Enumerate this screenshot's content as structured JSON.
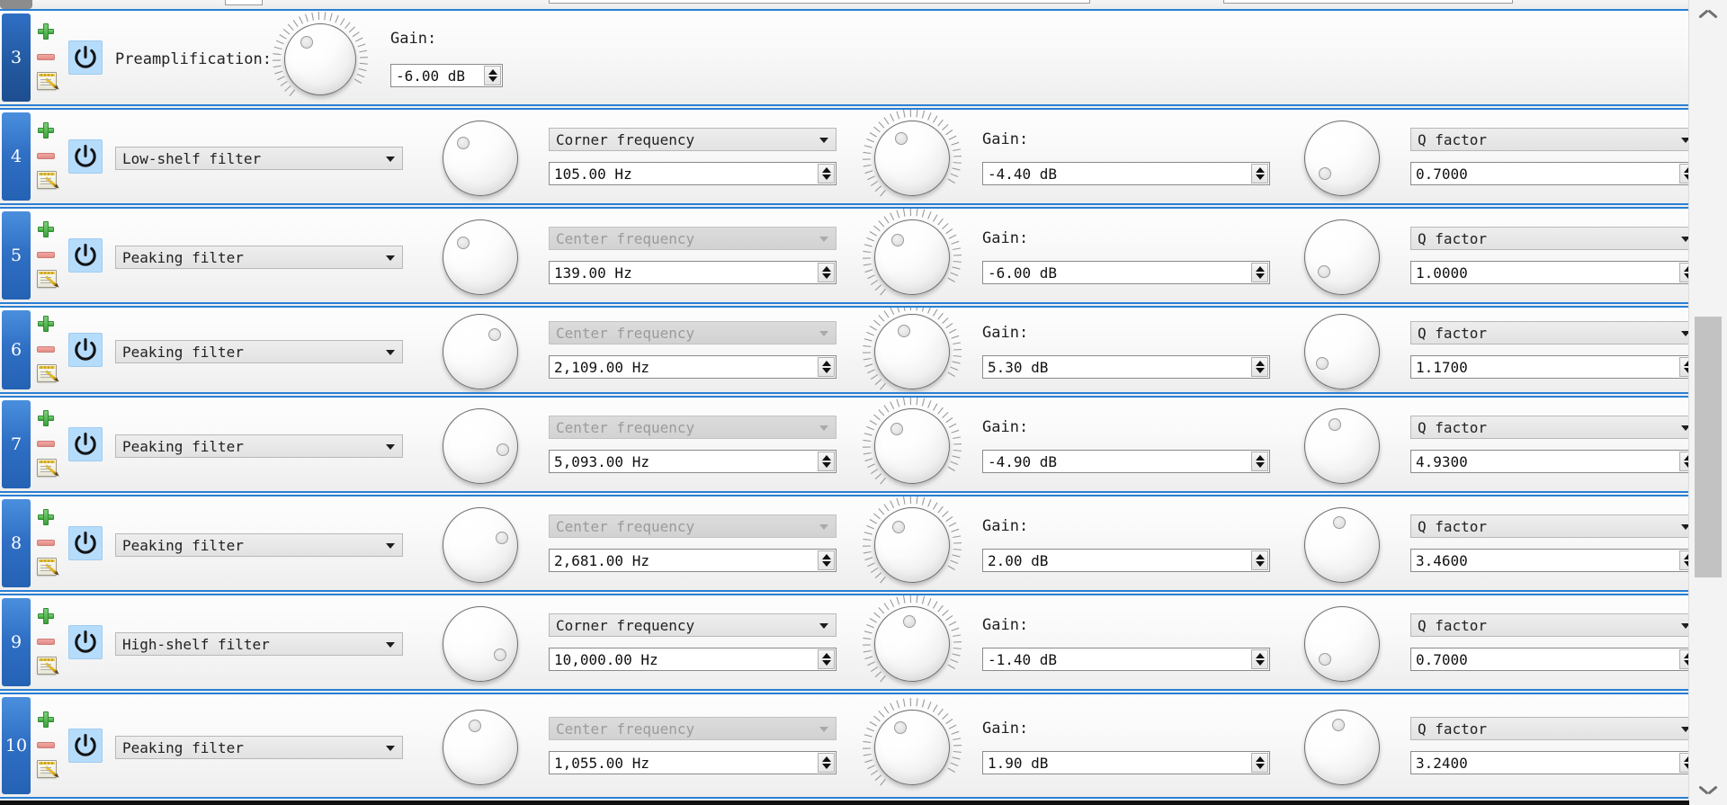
{
  "app": {
    "panel_name": "equalizer-filter-list",
    "accent_color": "#2a7fd4",
    "row_number_color": "#2f6fc4",
    "power_box_color": "#b6dcfb"
  },
  "labels": {
    "gain": "Gain:",
    "preamplification": "Preamplification:"
  },
  "icons": {
    "add": "plus-icon",
    "remove": "minus-icon",
    "edit": "note-edit-icon",
    "power": "power-icon",
    "dropdown": "chevron-down-icon",
    "spin_up": "spinner-up-icon",
    "spin_down": "spinner-down-icon",
    "scroll_up": "chevron-up-icon",
    "scroll_down": "chevron-down-icon"
  },
  "rows": [
    {
      "number": "3",
      "kind": "preamp",
      "label": "Preamplification:",
      "gain_label": "Gain:",
      "gain_value": "-6.00 dB",
      "gain_knob_angle": -38
    },
    {
      "number": "4",
      "kind": "filter",
      "filter_type": "Low-shelf filter",
      "freq_label": "Corner frequency",
      "freq_disabled": false,
      "freq_value": "105.00 Hz",
      "freq_knob_angle": -48,
      "gain_label": "Gain:",
      "gain_value": "-4.40 dB",
      "gain_knob_angle": -28,
      "q_label": "Q factor",
      "q_value": "0.7000",
      "q_knob_angle": -132
    },
    {
      "number": "5",
      "kind": "filter",
      "filter_type": "Peaking filter",
      "freq_label": "Center frequency",
      "freq_disabled": true,
      "freq_value": "139.00 Hz",
      "freq_knob_angle": -50,
      "gain_label": "Gain:",
      "gain_value": "-6.00 dB",
      "gain_knob_angle": -40,
      "q_label": "Q factor",
      "q_value": "1.0000",
      "q_knob_angle": -128
    },
    {
      "number": "6",
      "kind": "filter",
      "filter_type": "Peaking filter",
      "freq_label": "Center frequency",
      "freq_disabled": true,
      "freq_value": "2,109.00 Hz",
      "freq_knob_angle": 40,
      "gain_label": "Gain:",
      "gain_value": "5.30 dB",
      "gain_knob_angle": -22,
      "q_label": "Q factor",
      "q_value": "1.1700",
      "q_knob_angle": -120
    },
    {
      "number": "7",
      "kind": "filter",
      "filter_type": "Peaking filter",
      "freq_label": "Center frequency",
      "freq_disabled": true,
      "freq_value": "5,093.00 Hz",
      "freq_knob_angle": 100,
      "gain_label": "Gain:",
      "gain_value": "-4.90 dB",
      "gain_knob_angle": -42,
      "q_label": "Q factor",
      "q_value": "4.9300",
      "q_knob_angle": -18
    },
    {
      "number": "8",
      "kind": "filter",
      "filter_type": "Peaking filter",
      "freq_label": "Center frequency",
      "freq_disabled": true,
      "freq_value": "2,681.00 Hz",
      "freq_knob_angle": 72,
      "gain_label": "Gain:",
      "gain_value": "2.00 dB",
      "gain_knob_angle": -36,
      "q_label": "Q factor",
      "q_value": "3.4600",
      "q_knob_angle": -8
    },
    {
      "number": "9",
      "kind": "filter",
      "filter_type": "High-shelf filter",
      "freq_label": "Corner frequency",
      "freq_disabled": false,
      "freq_value": "10,000.00 Hz",
      "freq_knob_angle": 118,
      "gain_label": "Gain:",
      "gain_value": "-1.40 dB",
      "gain_knob_angle": -6,
      "q_label": "Q factor",
      "q_value": "0.7000",
      "q_knob_angle": -132
    },
    {
      "number": "10",
      "kind": "filter",
      "filter_type": "Peaking filter",
      "freq_label": "Center frequency",
      "freq_disabled": true,
      "freq_value": "1,055.00 Hz",
      "freq_knob_angle": -14,
      "gain_label": "Gain:",
      "gain_value": "1.90 dB",
      "gain_knob_angle": -30,
      "q_label": "Q factor",
      "q_value": "3.2400",
      "q_knob_angle": -10
    }
  ]
}
